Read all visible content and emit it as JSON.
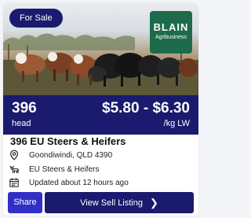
{
  "listing": {
    "status_badge": "For Sale",
    "brand": {
      "name": "BLAIN",
      "subtitle": "Agribusiness",
      "color": "#1e6b4c"
    },
    "head_count": "396",
    "head_unit": "head",
    "price_range": "$5.80 - $6.30",
    "price_unit": "/kg LW",
    "title": "396 EU Steers & Heifers",
    "location": "Goondiwindi, QLD 4390",
    "breed": "EU Steers & Heifers",
    "updated": "Updated about 12 hours ago"
  },
  "actions": {
    "share_label": "Share",
    "view_label": "View Sell Listing",
    "view_icon": "chevron-right-icon"
  },
  "icons": {
    "location": "map-pin-icon",
    "breed": "cattle-icon",
    "updated": "calendar-icon"
  },
  "colors": {
    "navy": "#1a1a6e",
    "share_blue": "#3030c8",
    "brand_green": "#1e6b4c"
  }
}
